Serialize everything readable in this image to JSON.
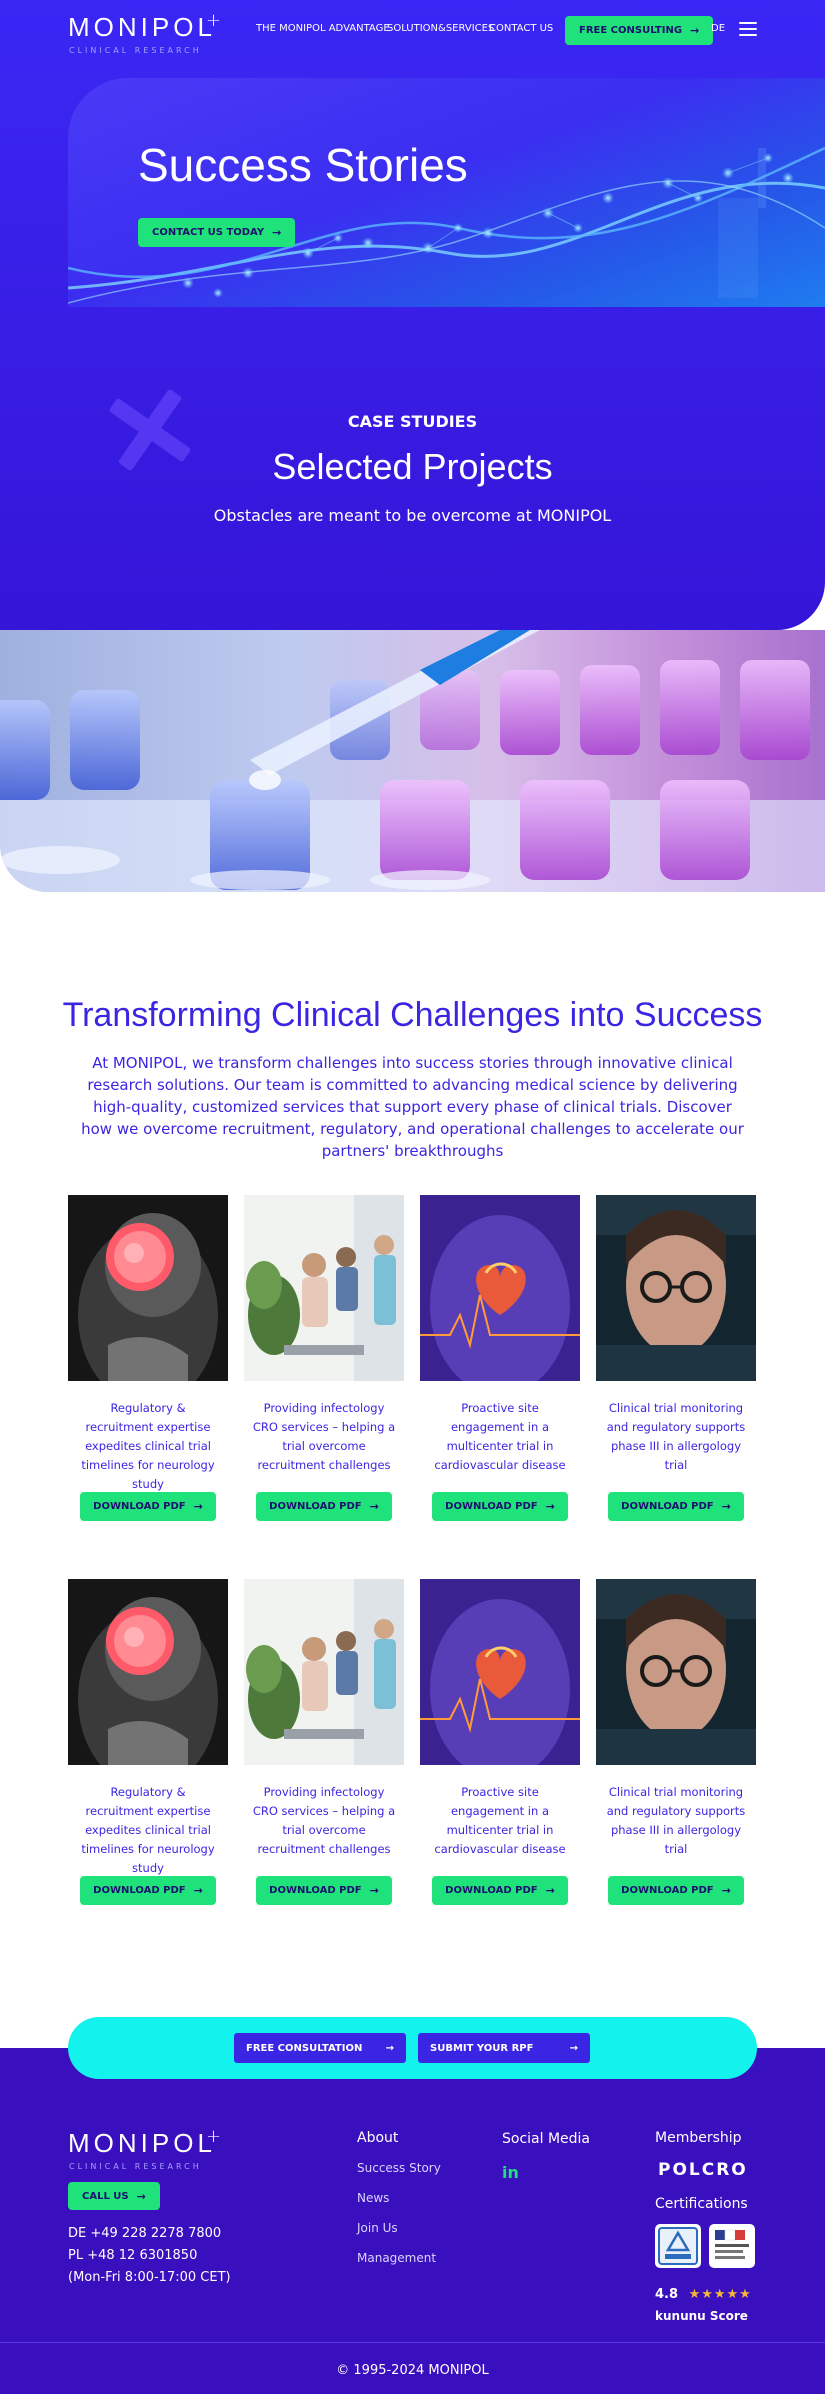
{
  "brand": {
    "name": "MONIPOL",
    "tagline": "CLINICAL RESEARCH"
  },
  "nav": {
    "items": [
      "THE MONIPOL ADVANTAGE",
      "SOLUTION&SERVICES",
      "CONTACT US"
    ],
    "cta": "FREE CONSULTING",
    "lang": "DE"
  },
  "hero": {
    "title": "Success Stories",
    "cta": "CONTACT US TODAY"
  },
  "case_studies": {
    "eyebrow": "CASE STUDIES",
    "title": "Selected Projects",
    "subtitle": "Obstacles are meant to be overcome at MONIPOL"
  },
  "intro": {
    "title": "Transforming Clinical Challenges into Success",
    "text": "At MONIPOL, we transform challenges into success stories through innovative clinical research solutions. Our team is committed to advancing medical science by delivering high-quality, customized services that support every phase of clinical trials. Discover how we overcome recruitment, regulatory, and operational challenges to accelerate our partners' breakthroughs"
  },
  "cards": [
    {
      "caption": "Regulatory & recruitment expertise expedites clinical trial timelines for neurology study",
      "button": "DOWNLOAD PDF",
      "image": "brain-scan"
    },
    {
      "caption": "Providing infectology CRO services – helping a trial overcome recruitment challenges",
      "button": "DOWNLOAD PDF",
      "image": "waiting-room"
    },
    {
      "caption": "Proactive site engagement in a multicenter trial in cardiovascular disease",
      "button": "DOWNLOAD PDF",
      "image": "heart"
    },
    {
      "caption": "Clinical trial monitoring and regulatory supports phase III in allergology trial",
      "button": "DOWNLOAD PDF",
      "image": "woman-glasses"
    },
    {
      "caption": "Regulatory & recruitment expertise expedites clinical trial timelines for neurology study",
      "button": "DOWNLOAD PDF",
      "image": "brain-scan"
    },
    {
      "caption": "Providing infectology CRO services – helping a trial overcome recruitment challenges",
      "button": "DOWNLOAD PDF",
      "image": "waiting-room"
    },
    {
      "caption": "Proactive site engagement in a multicenter trial in cardiovascular disease",
      "button": "DOWNLOAD PDF",
      "image": "heart"
    },
    {
      "caption": "Clinical trial monitoring and regulatory supports phase III in allergology trial",
      "button": "DOWNLOAD PDF",
      "image": "woman-glasses"
    }
  ],
  "cta_bar": {
    "consultation": "FREE CONSULTATION",
    "rpf": "SUBMIT YOUR RPF"
  },
  "footer": {
    "call": "CALL US",
    "phones": [
      "DE +49 228 2278 7800",
      "PL +48 12 6301850",
      "(Mon-Fri 8:00-17:00 CET)"
    ],
    "about_heading": "About",
    "about_links": [
      "Success Story",
      "News",
      "Join Us",
      "Management"
    ],
    "social_heading": "Social Media",
    "social_icon": "linkedin-icon",
    "linkedin": "in",
    "membership_heading": "Membership",
    "membership": "POLCRO",
    "certifications_heading": "Certifications",
    "rating": "4.8",
    "stars": "★★★★★",
    "rating_source": "kununu Score",
    "copyright": "© 1995-2024 MONIPOL"
  },
  "colors": {
    "primary": "#3a26e2",
    "accent_green": "#1fe37a",
    "accent_cyan": "#13f2ec",
    "footer_bg": "#3a0fbd"
  }
}
